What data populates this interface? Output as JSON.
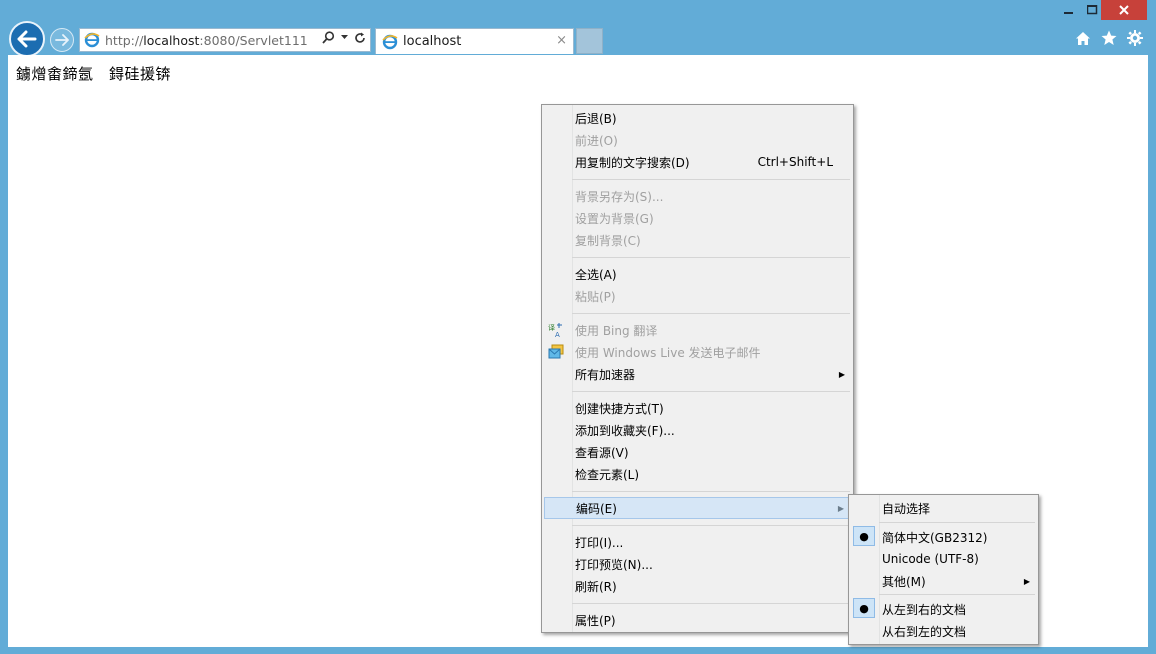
{
  "window": {
    "min_icon": "minimize-icon",
    "max_icon": "maximize-icon",
    "close_icon": "close-icon"
  },
  "address": {
    "url_prefix": "http://",
    "url_host": "localhost",
    "url_rest": ":8080/Servlet111"
  },
  "tab": {
    "title": "localhost",
    "close": "×"
  },
  "page": {
    "text": "鐪熷畬鍗氬　鍀硅援锛"
  },
  "context_menu": {
    "items": [
      {
        "label": "后退(B)",
        "disabled": false
      },
      {
        "label": "前进(O)",
        "disabled": true
      },
      {
        "label": "用复制的文字搜索(D)",
        "shortcut": "Ctrl+Shift+L",
        "disabled": false
      },
      {
        "label": "背景另存为(S)...",
        "disabled": true
      },
      {
        "label": "设置为背景(G)",
        "disabled": true
      },
      {
        "label": "复制背景(C)",
        "disabled": true
      },
      {
        "label": "全选(A)",
        "disabled": false
      },
      {
        "label": "粘贴(P)",
        "disabled": true
      },
      {
        "label": "使用 Bing 翻译",
        "disabled": true,
        "icon": "translate-icon"
      },
      {
        "label": "使用 Windows Live 发送电子邮件",
        "disabled": true,
        "icon": "email-icon"
      },
      {
        "label": "所有加速器",
        "disabled": false,
        "submenu": true
      },
      {
        "label": "创建快捷方式(T)",
        "disabled": false
      },
      {
        "label": "添加到收藏夹(F)...",
        "disabled": false
      },
      {
        "label": "查看源(V)",
        "disabled": false
      },
      {
        "label": "检查元素(L)",
        "disabled": false
      },
      {
        "label": "编码(E)",
        "disabled": false,
        "submenu": true,
        "highlighted": true
      },
      {
        "label": "打印(I)...",
        "disabled": false
      },
      {
        "label": "打印预览(N)...",
        "disabled": false
      },
      {
        "label": "刷新(R)",
        "disabled": false
      },
      {
        "label": "属性(P)",
        "disabled": false
      }
    ]
  },
  "encoding_menu": {
    "items": [
      {
        "label": "自动选择",
        "checked": false
      },
      {
        "label": "简体中文(GB2312)",
        "checked": true
      },
      {
        "label": "Unicode (UTF-8)",
        "checked": false
      },
      {
        "label": "其他(M)",
        "checked": false,
        "submenu": true
      },
      {
        "label": "从左到右的文档",
        "checked": true
      },
      {
        "label": "从右到左的文档",
        "checked": false
      }
    ]
  }
}
